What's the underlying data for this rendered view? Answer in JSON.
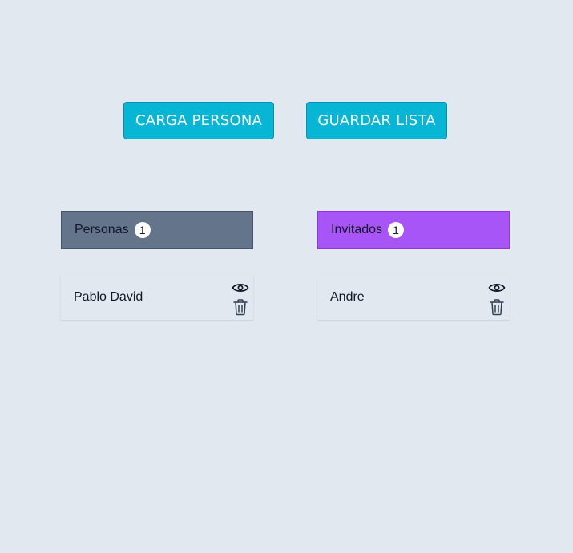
{
  "toolbar": {
    "carga_label": "CARGA PERSONA",
    "guardar_label": "GUARDAR LISTA"
  },
  "personas": {
    "title": "Personas",
    "count": "1",
    "items": [
      {
        "name": "Pablo David"
      }
    ]
  },
  "invitados": {
    "title": "Invitados",
    "count": "1",
    "items": [
      {
        "name": "Andre"
      }
    ]
  },
  "icons": {
    "view": "eye-icon",
    "delete": "trash-icon"
  },
  "colors": {
    "background": "#e2e8f0",
    "button": "#06b6d4",
    "personas_header": "#64748b",
    "invitados_header": "#a855f7"
  }
}
